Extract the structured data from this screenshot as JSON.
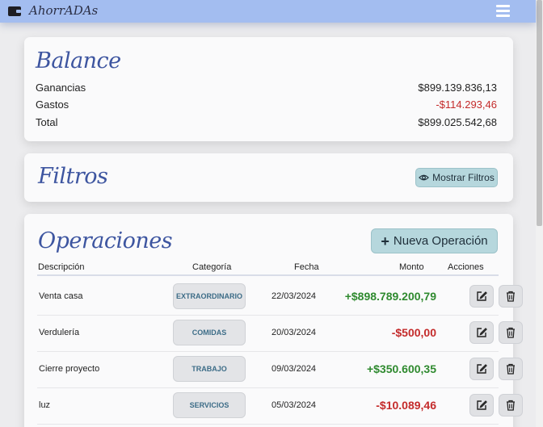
{
  "app": {
    "brand": "AhorrADAs"
  },
  "balance": {
    "title": "Balance",
    "rows": [
      {
        "label": "Ganancias",
        "value": "$899.139.836,13"
      },
      {
        "label": "Gastos",
        "value": "-$114.293,46"
      },
      {
        "label": "Total",
        "value": "$899.025.542,68"
      }
    ]
  },
  "filters": {
    "title": "Filtros",
    "toggle_label": "Mostrar Filtros"
  },
  "operations": {
    "title": "Operaciones",
    "new_label": "Nueva Operación",
    "headers": {
      "description": "Descripción",
      "category": "Categoría",
      "date": "Fecha",
      "amount": "Monto",
      "actions": "Acciones"
    },
    "rows": [
      {
        "description": "Venta casa",
        "category": "EXTRAORDINARIO",
        "date": "22/03/2024",
        "amount": "+$898.789.200,79",
        "kind": "income"
      },
      {
        "description": "Verdulería",
        "category": "COMIDAS",
        "date": "20/03/2024",
        "amount": "-$500,00",
        "kind": "expense"
      },
      {
        "description": "Cierre proyecto",
        "category": "TRABAJO",
        "date": "09/03/2024",
        "amount": "+$350.600,35",
        "kind": "income"
      },
      {
        "description": "luz",
        "category": "SERVICIOS",
        "date": "05/03/2024",
        "amount": "-$10.089,46",
        "kind": "expense"
      }
    ]
  },
  "colors": {
    "navbar": "#a3bdf0",
    "accent_title": "#3d55a0",
    "income": "#2f8a2f",
    "expense": "#c42b2b",
    "button": "#b6d7dd"
  },
  "icons": {
    "wallet": "wallet-icon",
    "menu": "hamburger-menu-icon",
    "eye": "eye-icon",
    "plus": "plus-icon",
    "edit": "edit-icon",
    "delete": "trash-icon"
  }
}
